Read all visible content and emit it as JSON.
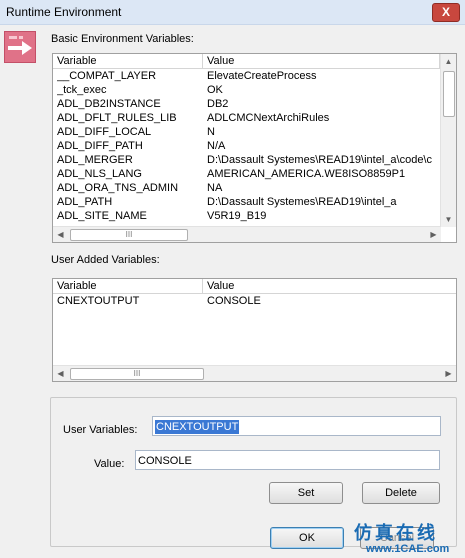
{
  "window": {
    "title": "Runtime Environment",
    "close_glyph": "X"
  },
  "basic": {
    "label": "Basic Environment Variables:",
    "columns": [
      "Variable",
      "Value"
    ],
    "rows": [
      [
        "__COMPAT_LAYER",
        "ElevateCreateProcess"
      ],
      [
        "_tck_exec",
        "OK"
      ],
      [
        "ADL_DB2INSTANCE",
        "DB2"
      ],
      [
        "ADL_DFLT_RULES_LIB",
        "ADLCMCNextArchiRules"
      ],
      [
        "ADL_DIFF_LOCAL",
        "N"
      ],
      [
        "ADL_DIFF_PATH",
        "N/A"
      ],
      [
        "ADL_MERGER",
        "D:\\Dassault Systemes\\READ19\\intel_a\\code\\c"
      ],
      [
        "ADL_NLS_LANG",
        "AMERICAN_AMERICA.WE8ISO8859P1"
      ],
      [
        "ADL_ORA_TNS_ADMIN",
        "NA"
      ],
      [
        "ADL_PATH",
        "D:\\Dassault Systemes\\READ19\\intel_a"
      ],
      [
        "ADL_SITE_NAME",
        "V5R19_B19"
      ]
    ],
    "scroll_grip": "III"
  },
  "user": {
    "label": "User Added Variables:",
    "columns": [
      "Variable",
      "Value"
    ],
    "rows": [
      [
        "CNEXTOUTPUT",
        "CONSOLE"
      ]
    ],
    "scroll_grip": "III"
  },
  "editor": {
    "user_variables_label": "User Variables:",
    "user_variables_value": "CNEXTOUTPUT",
    "value_label": "Value:",
    "value_value": "CONSOLE",
    "set_label": "Set",
    "delete_label": "Delete"
  },
  "footer": {
    "ok_label": "OK",
    "cancel_label": "Cancel"
  },
  "watermark": {
    "cn": "仿真在线",
    "url": "www.1CAE.com"
  },
  "icons": {
    "app": "arrow-right-icon",
    "scroll_up": "▲",
    "scroll_down": "▼",
    "scroll_left": "◀",
    "scroll_right": "▶"
  }
}
